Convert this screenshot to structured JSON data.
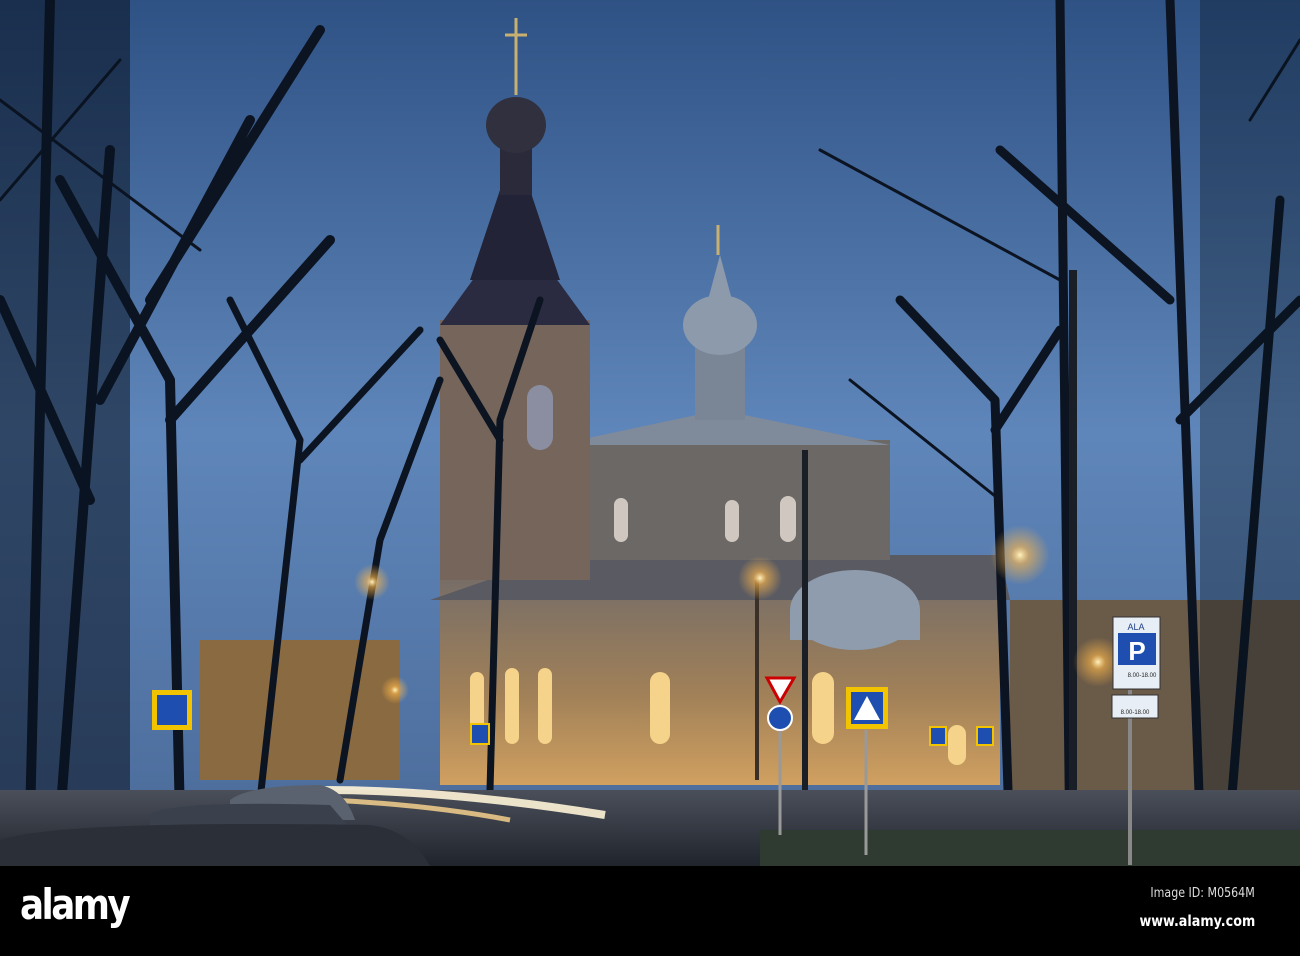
{
  "photo": {
    "subject": "Orthodox church at dusk with bare trees and street lights",
    "signs": {
      "parking_header": "ALA",
      "parking_letter": "P",
      "parking_hours": "8.00-18.00",
      "sub_hours": "8.00-18.00"
    }
  },
  "watermark": {
    "logo": "alamy",
    "image_id": "Image ID: M0564M",
    "site": "www.alamy.com"
  },
  "colors": {
    "sky_top": "#2f5285",
    "sky_bottom": "#6f93c4",
    "banner": "#000000",
    "lamp": "#ffb84a"
  }
}
